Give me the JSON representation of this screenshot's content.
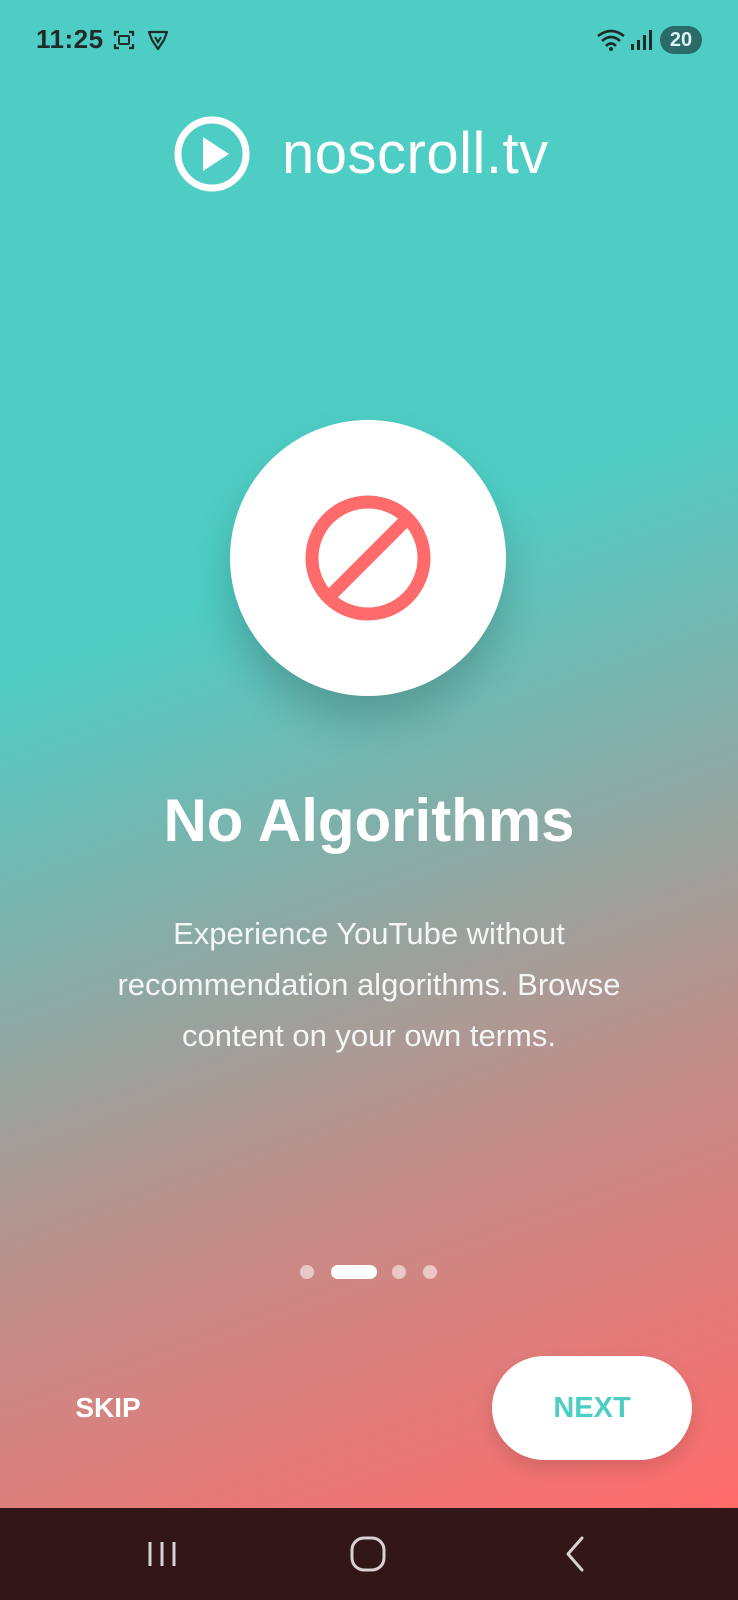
{
  "status_bar": {
    "time": "11:25",
    "battery": "20",
    "icons": [
      "screenshot-icon",
      "vpn-shield-icon",
      "wifi-icon",
      "signal-icon"
    ]
  },
  "app": {
    "logo_text": "noscroll.tv",
    "logo_icon": "play-circle-icon"
  },
  "onboarding": {
    "hero_icon": "block-icon",
    "hero_icon_color": "#ff6b6b",
    "title": "No Algorithms",
    "description": "Experience YouTube without recommendation algorithms. Browse content on your own terms.",
    "page_count": 4,
    "current_page": 2
  },
  "actions": {
    "skip_label": "SKIP",
    "next_label": "NEXT"
  },
  "nav_bar": {
    "buttons": [
      "recent-apps-icon",
      "home-icon",
      "back-icon"
    ]
  },
  "colors": {
    "accent_teal": "#4ecdc4",
    "accent_coral": "#ff6b6b",
    "nav_bar": "#321618"
  }
}
